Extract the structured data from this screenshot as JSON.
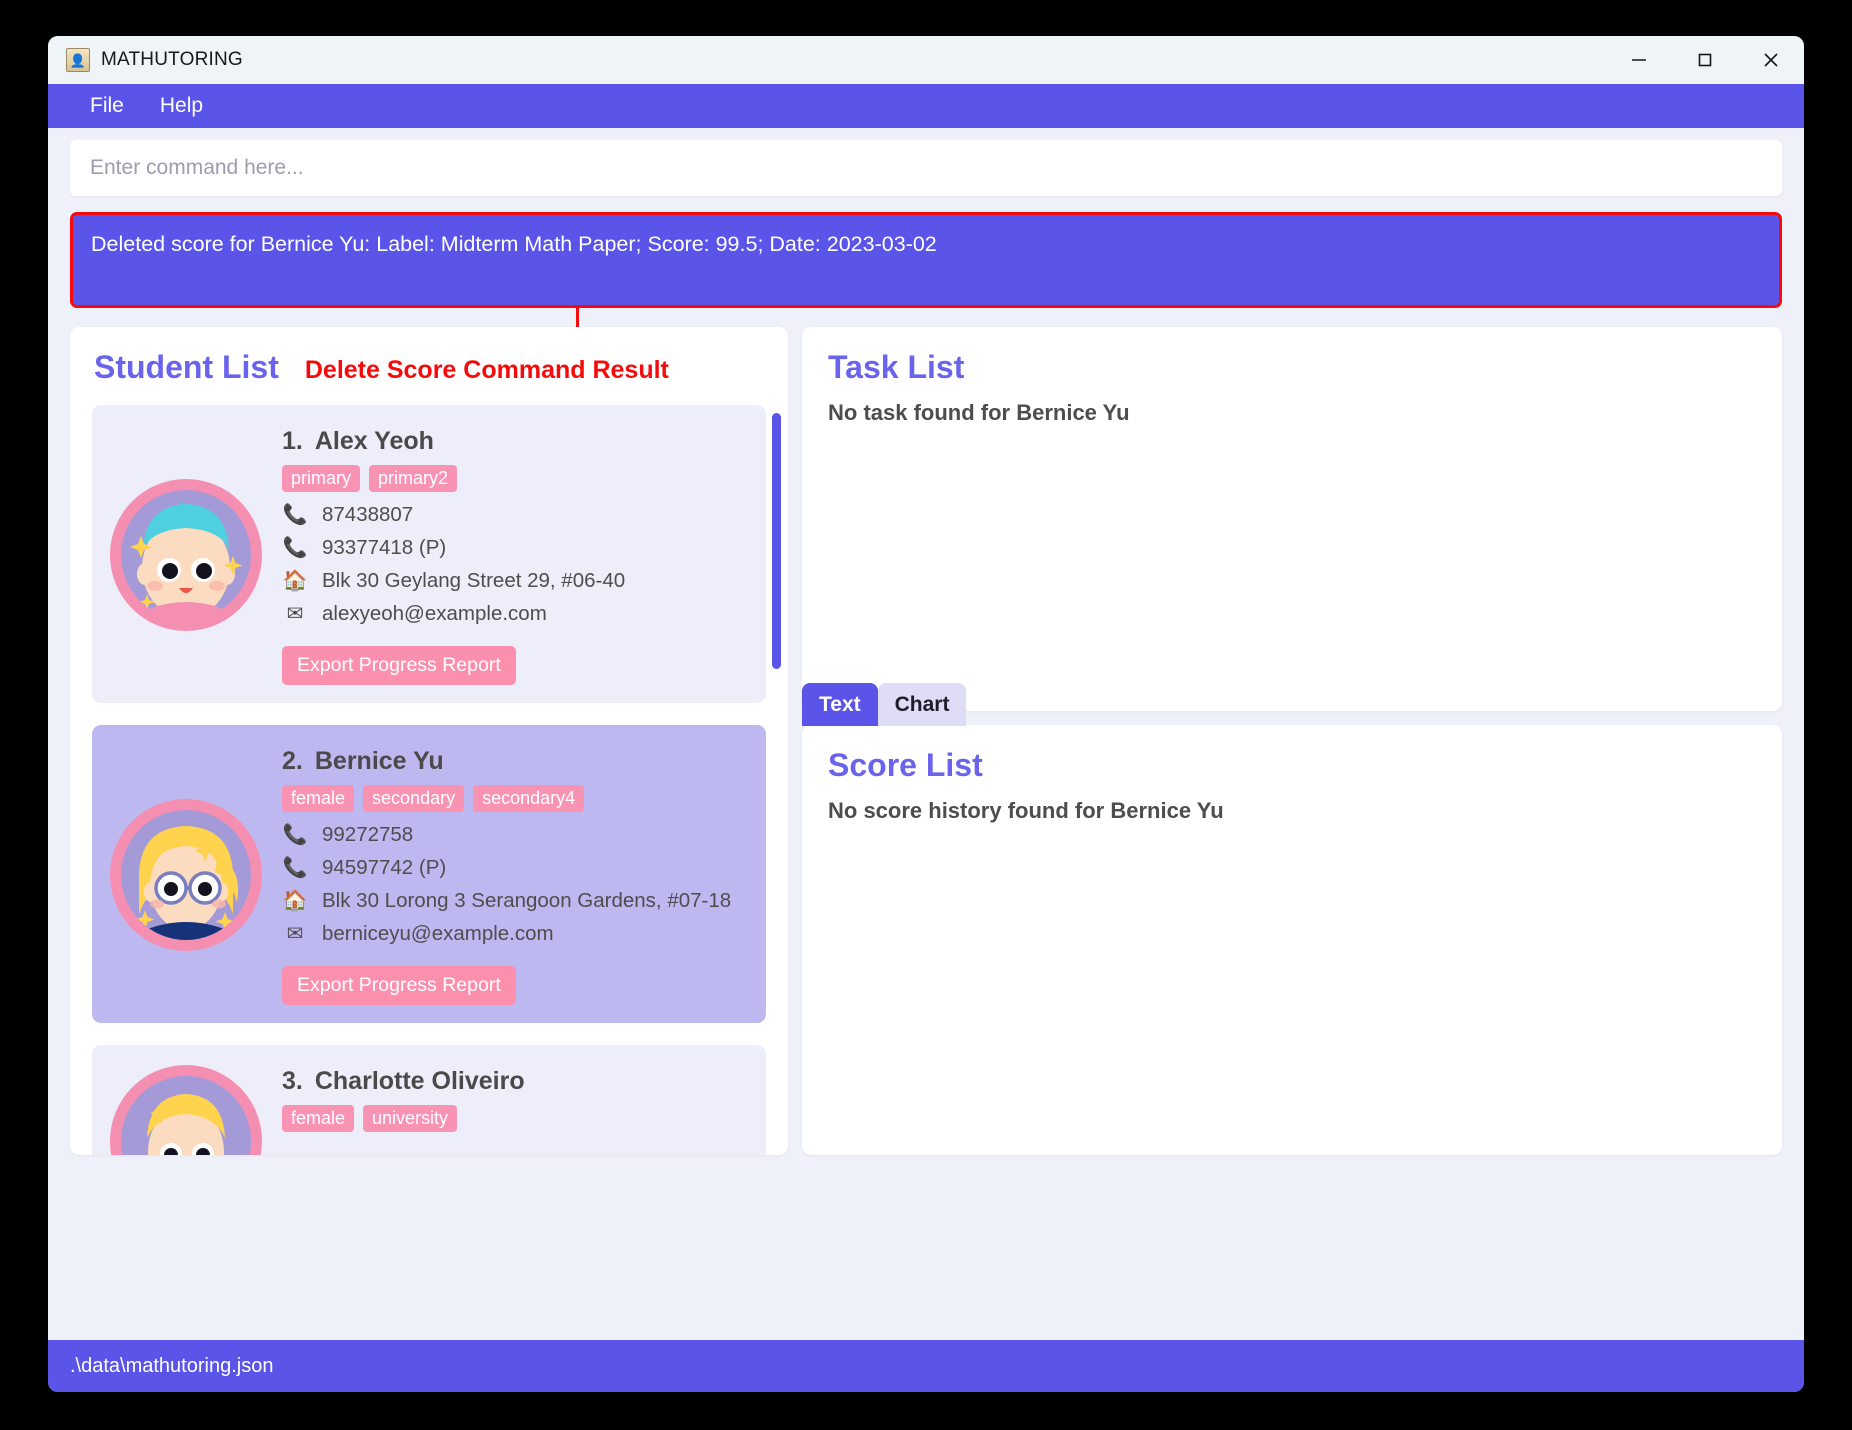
{
  "window": {
    "title": "MATHUTORING",
    "app_icon": "contact-book-icon",
    "controls": {
      "minimize": "minimize-icon",
      "maximize": "maximize-icon",
      "close": "close-icon"
    }
  },
  "menubar": {
    "items": [
      {
        "label": "File"
      },
      {
        "label": "Help"
      }
    ]
  },
  "command": {
    "placeholder": "Enter command here...",
    "value": ""
  },
  "result": {
    "text": "Deleted score for Bernice Yu: Label: Midterm Math Paper; Score: 99.5; Date: 2023-03-02",
    "annotation": "Delete Score Command Result",
    "border_color": "#f50b0b",
    "background_color": "#5a54e8"
  },
  "student_panel": {
    "title": "Student List",
    "students": [
      {
        "index": "1.",
        "name": "Alex Yeoh",
        "selected": false,
        "tags": [
          "primary",
          "primary2"
        ],
        "phone": "87438807",
        "parent_phone": "93377418 (P)",
        "address": "Blk 30 Geylang Street 29, #06-40",
        "email": "alexyeoh@example.com",
        "export_label": "Export Progress Report",
        "avatar": "boy-blue-hair-avatar"
      },
      {
        "index": "2.",
        "name": "Bernice Yu",
        "selected": true,
        "tags": [
          "female",
          "secondary",
          "secondary4"
        ],
        "phone": "99272758",
        "parent_phone": "94597742 (P)",
        "address": "Blk 30 Lorong 3 Serangoon Gardens, #07-18",
        "email": "berniceyu@example.com",
        "export_label": "Export Progress Report",
        "avatar": "girl-glasses-blonde-avatar"
      },
      {
        "index": "3.",
        "name": "Charlotte Oliveiro",
        "selected": false,
        "tags": [
          "female",
          "university"
        ],
        "phone": "",
        "parent_phone": "",
        "address": "",
        "email": "",
        "export_label": "",
        "avatar": "girl-blonde-avatar"
      }
    ],
    "icons": {
      "phone": "phone-icon",
      "address": "house-icon",
      "email": "envelope-icon"
    }
  },
  "task_panel": {
    "title": "Task List",
    "empty_message": "No task found for Bernice Yu"
  },
  "score_panel": {
    "tabs": [
      {
        "label": "Text",
        "active": true
      },
      {
        "label": "Chart",
        "active": false
      }
    ],
    "title": "Score List",
    "empty_message": "No score history found for Bernice Yu"
  },
  "statusbar": {
    "path": ".\\data\\mathutoring.json"
  },
  "colors": {
    "accent": "#5a54e8",
    "title_purple": "#6a64ec",
    "tag_pink": "#f993b4",
    "button_pink": "#fa90ae",
    "annotation_red": "#f50b0b",
    "card_bg": "#eeedfa",
    "card_selected_bg": "#bdb9f0"
  }
}
